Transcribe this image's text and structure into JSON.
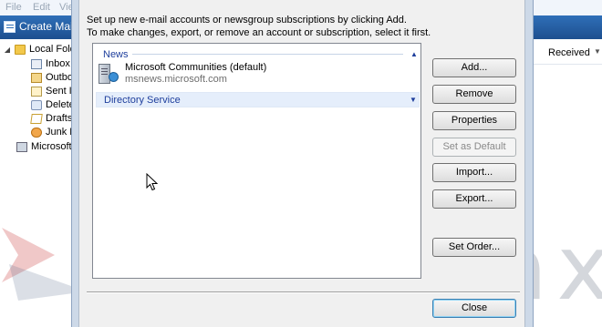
{
  "app": {
    "menu": [
      "File",
      "Edit",
      "View"
    ],
    "create_mail": "Create Mail",
    "received_col": "Received",
    "folders": [
      {
        "label": "Local Folders",
        "icon": "folder-icon"
      },
      {
        "label": "Inbox",
        "icon": "inbox-icon"
      },
      {
        "label": "Outbox",
        "icon": "outbox-icon"
      },
      {
        "label": "Sent Items",
        "icon": "sent-items-icon"
      },
      {
        "label": "Deleted Items",
        "icon": "deleted-items-icon"
      },
      {
        "label": "Drafts",
        "icon": "drafts-icon"
      },
      {
        "label": "Junk E-mail",
        "icon": "junk-icon"
      },
      {
        "label": "Microsoft Communities",
        "icon": "server-icon"
      }
    ]
  },
  "dialog": {
    "instruction_line1": "Set up new e-mail accounts or newsgroup subscriptions by clicking Add.",
    "instruction_line2": "To make changes, export, or remove an account or subscription, select it first.",
    "groups": {
      "news": "News",
      "directory": "Directory Service"
    },
    "account": {
      "name": "Microsoft Communities (default)",
      "server": "msnews.microsoft.com"
    },
    "buttons": {
      "add": "Add...",
      "remove": "Remove",
      "properties": "Properties",
      "set_default": "Set as Default",
      "import": "Import...",
      "export": "Export...",
      "set_order": "Set Order...",
      "close": "Close"
    }
  },
  "watermark": "mediawax",
  "colors": {
    "toolbar_blue": "#2f6fb8",
    "group_header_text": "#1e3e9c",
    "selected_group_bg": "#e5eefb",
    "watermark_red": "#c83a3a"
  }
}
